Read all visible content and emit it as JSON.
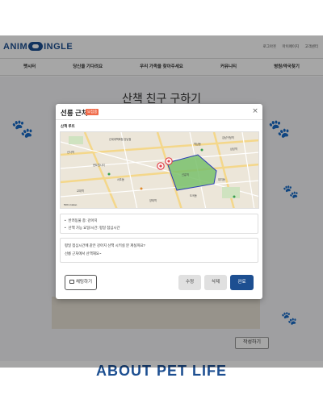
{
  "site": {
    "logo_left": "ANIM",
    "logo_right": "INGLE",
    "top_links": [
      "로그아웃",
      "마이페이지",
      "고객센터"
    ],
    "nav": [
      "펫시터",
      "당신을 기다려요",
      "우리 가족을 찾아주세요",
      "커뮤니티",
      "병원/약국찾기"
    ],
    "page_title": "산책 친구 구하기",
    "compose_label": "작성하기",
    "about_title": "ABOUT PET LIFE"
  },
  "modal": {
    "title": "선릉 근처",
    "status": "모집중",
    "close_symbol": "×",
    "route_label": "산책 루트",
    "map_labels": [
      "신세계백화점 강남점",
      "신사역",
      "센트럴시티",
      "서초동",
      "선릉역",
      "삼성역",
      "역삼동",
      "교대역",
      "대치동",
      "양재역",
      "도곡동",
      "강남구청역"
    ],
    "info": [
      "반려동물 종: 강아지",
      "산책 가능 요일/시간: 평일 점심시간"
    ],
    "description": [
      "평일 점심시간에 같은 강아지 산책 시키실 분 계실까요?",
      "선릉 근처에서 산책해요~"
    ],
    "buttons": {
      "chat": "채팅하기",
      "edit": "수정",
      "delete": "삭제",
      "done": "완료"
    },
    "map_scale": "500m kakao"
  }
}
